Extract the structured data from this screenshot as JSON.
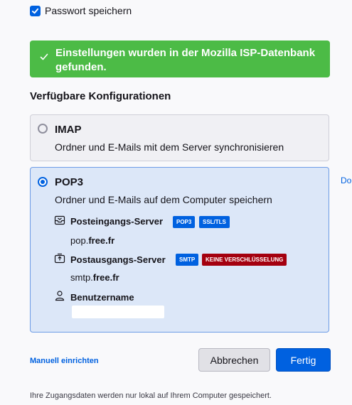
{
  "remember_password": {
    "label": "Passwort speichern",
    "checked": true
  },
  "success_banner": {
    "line1": "Einstellungen wurden in der Mozilla ISP-Datenbank",
    "line2": "gefunden."
  },
  "section_title": "Verfügbare Konfigurationen",
  "configs": [
    {
      "title": "IMAP",
      "description": "Ordner und E-Mails mit dem Server synchronisieren",
      "selected": false
    },
    {
      "title": "POP3",
      "description": "Ordner und E-Mails auf dem Computer speichern",
      "selected": true,
      "incoming": {
        "label": "Posteingangs-Server",
        "badges": [
          "POP3",
          "SSL/TLS"
        ],
        "host_prefix": "pop.",
        "host_domain": "free.fr"
      },
      "outgoing": {
        "label": "Postausgangs-Server",
        "badges": [
          "SMTP",
          "KEINE VERSCHLÜSSELUNG"
        ],
        "host_prefix": "smtp.",
        "host_domain": "free.fr"
      },
      "username": {
        "label": "Benutzername",
        "value": ""
      }
    }
  ],
  "side_link": "Do",
  "manual_link": "Manuell einrichten",
  "buttons": {
    "cancel": "Abbrechen",
    "done": "Fertig"
  },
  "footer_note": "Ihre Zugangsdaten werden nur lokal auf Ihrem Computer gespeichert.",
  "colors": {
    "accent": "#0061e0",
    "success": "#4cbb46",
    "danger_badge": "#a4000f",
    "selected_card_bg": "#dce7f8"
  }
}
